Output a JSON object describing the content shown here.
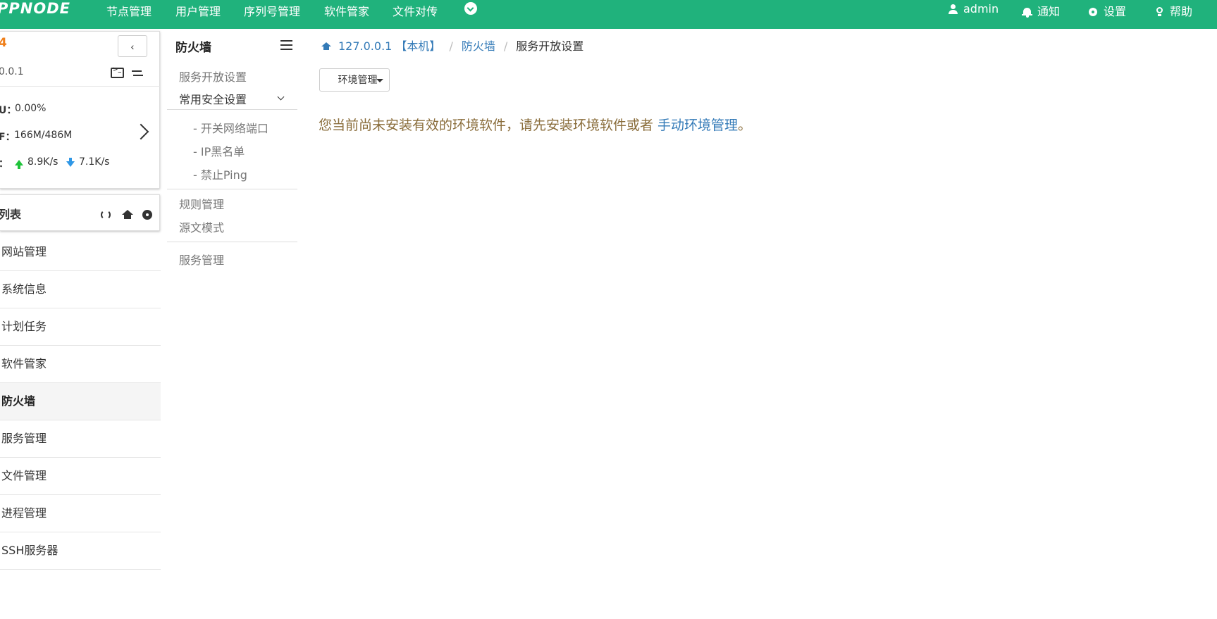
{
  "topbar": {
    "logo": "PPNODE",
    "nav": [
      "节点管理",
      "用户管理",
      "序列号管理",
      "软件管家",
      "文件对传"
    ],
    "user": "admin",
    "notify": "通知",
    "settings": "设置",
    "help": "帮助",
    "bg_color": "#20b27c"
  },
  "node": {
    "ip_short": "0.0.1",
    "cpu_label": "U：",
    "cpu_value": "0.00%",
    "mem_label": "F：",
    "mem_value": "166M/486M",
    "net_label": "：",
    "net_up": "8.9K/s",
    "net_down": "7.1K/s",
    "collapse_label": "‹"
  },
  "module_list": {
    "title": "列表",
    "items": [
      "网站管理",
      "系统信息",
      "计划任务",
      "软件管家",
      "防火墙",
      "服务管理",
      "文件管理",
      "进程管理",
      "SSH服务器"
    ],
    "active": "防火墙"
  },
  "midnav": {
    "title": "防火墙",
    "service_open": "服务开放设置",
    "security_group": "常用安全设置",
    "sub_items": [
      "- 开关网络端口",
      "- IP黑名单",
      "- 禁止Ping"
    ],
    "rules": "规则管理",
    "source_mode": "源文模式",
    "service_mgmt": "服务管理"
  },
  "breadcrumb": {
    "host": "127.0.0.1 【本机】",
    "section": "防火墙",
    "current": "服务开放设置"
  },
  "content": {
    "env_button": "环境管理",
    "warning_text": "您当前尚未安装有效的环境软件，请先安装环境软件或者 ",
    "warning_link": "手动环境管理",
    "warning_end": "。"
  }
}
